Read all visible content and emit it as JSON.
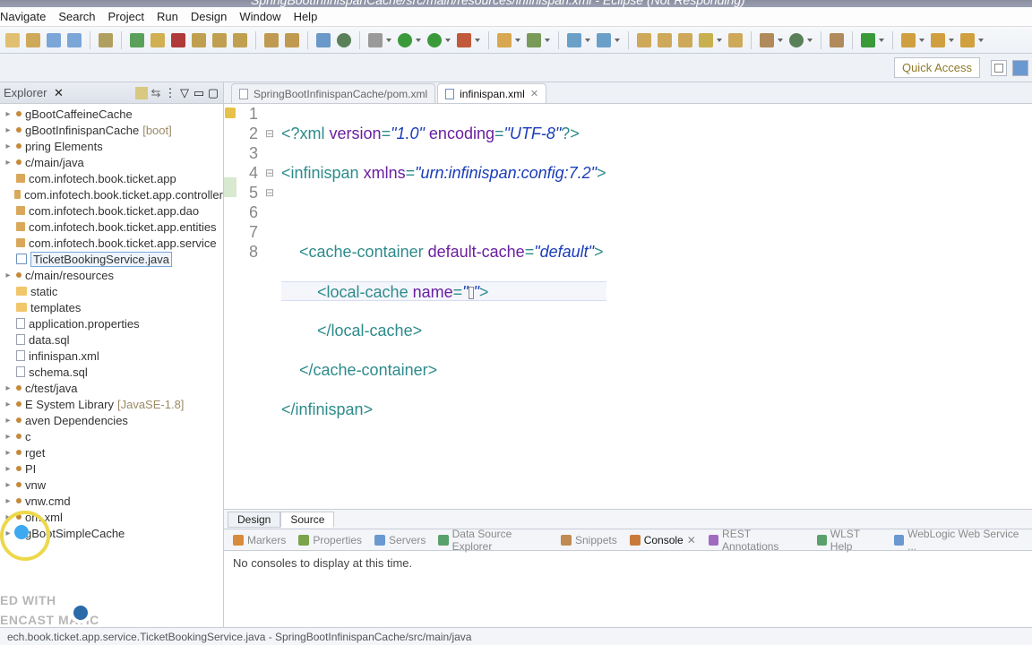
{
  "title": "SpringBootInfinispanCache/src/main/resources/infinispan.xml - Eclipse (Not Responding)",
  "menu": [
    "Navigate",
    "Search",
    "Project",
    "Run",
    "Design",
    "Window",
    "Help"
  ],
  "quick_access": "Quick Access",
  "sidebar": {
    "title": "Explorer",
    "items": [
      {
        "t": "gBootCaffeineCache"
      },
      {
        "t": "gBootInfinispanCache",
        "suffix": "[boot]"
      },
      {
        "t": "pring Elements"
      },
      {
        "t": "c/main/java"
      },
      {
        "t": "com.infotech.book.ticket.app",
        "k": "pkg"
      },
      {
        "t": "com.infotech.book.ticket.app.controller",
        "k": "pkg"
      },
      {
        "t": "com.infotech.book.ticket.app.dao",
        "k": "pkg"
      },
      {
        "t": "com.infotech.book.ticket.app.entities",
        "k": "pkg"
      },
      {
        "t": "com.infotech.book.ticket.app.service",
        "k": "pkg"
      },
      {
        "t": "TicketBookingService.java",
        "k": "java",
        "sel": true
      },
      {
        "t": "c/main/resources"
      },
      {
        "t": "static",
        "k": "fold"
      },
      {
        "t": "templates",
        "k": "fold"
      },
      {
        "t": "application.properties",
        "k": "file"
      },
      {
        "t": "data.sql",
        "k": "file"
      },
      {
        "t": "infinispan.xml",
        "k": "file"
      },
      {
        "t": "schema.sql",
        "k": "file"
      },
      {
        "t": "c/test/java"
      },
      {
        "t": "E System Library",
        "suffix": "[JavaSE-1.8]"
      },
      {
        "t": "aven Dependencies"
      },
      {
        "t": "c"
      },
      {
        "t": "rget"
      },
      {
        "t": "PI"
      },
      {
        "t": "vnw"
      },
      {
        "t": "vnw.cmd"
      },
      {
        "t": "om.xml"
      },
      {
        "t": "gBootSimpleCache"
      }
    ]
  },
  "editor_tabs": [
    {
      "label": "SpringBootInfinispanCache/pom.xml",
      "active": false
    },
    {
      "label": "infinispan.xml",
      "active": true
    }
  ],
  "code": {
    "lines": [
      1,
      2,
      3,
      4,
      5,
      6,
      7,
      8
    ],
    "l1_ver": "1.0",
    "l1_enc": "UTF-8",
    "l2_ns": "urn:infinispan:config:7.2",
    "l4_def": "default"
  },
  "design_tab": "Design",
  "source_tab": "Source",
  "views": [
    {
      "label": "Markers",
      "c": "#d88b3a"
    },
    {
      "label": "Properties",
      "c": "#7aa34a"
    },
    {
      "label": "Servers",
      "c": "#6a98d0"
    },
    {
      "label": "Data Source Explorer",
      "c": "#5aa06a"
    },
    {
      "label": "Snippets",
      "c": "#c08a50"
    },
    {
      "label": "Console",
      "c": "#c97a3a",
      "active": true
    },
    {
      "label": "REST Annotations",
      "c": "#a06ac0"
    },
    {
      "label": "WLST Help",
      "c": "#5aa06a"
    },
    {
      "label": "WebLogic Web Service ...",
      "c": "#6a98d0"
    }
  ],
  "console_msg": "No consoles to display at this time.",
  "status": "ech.book.ticket.app.service.TicketBookingService.java - SpringBootInfinispanCache/src/main/java",
  "watermark1": "ED WITH",
  "watermark2": "ENCAST    MATIC"
}
